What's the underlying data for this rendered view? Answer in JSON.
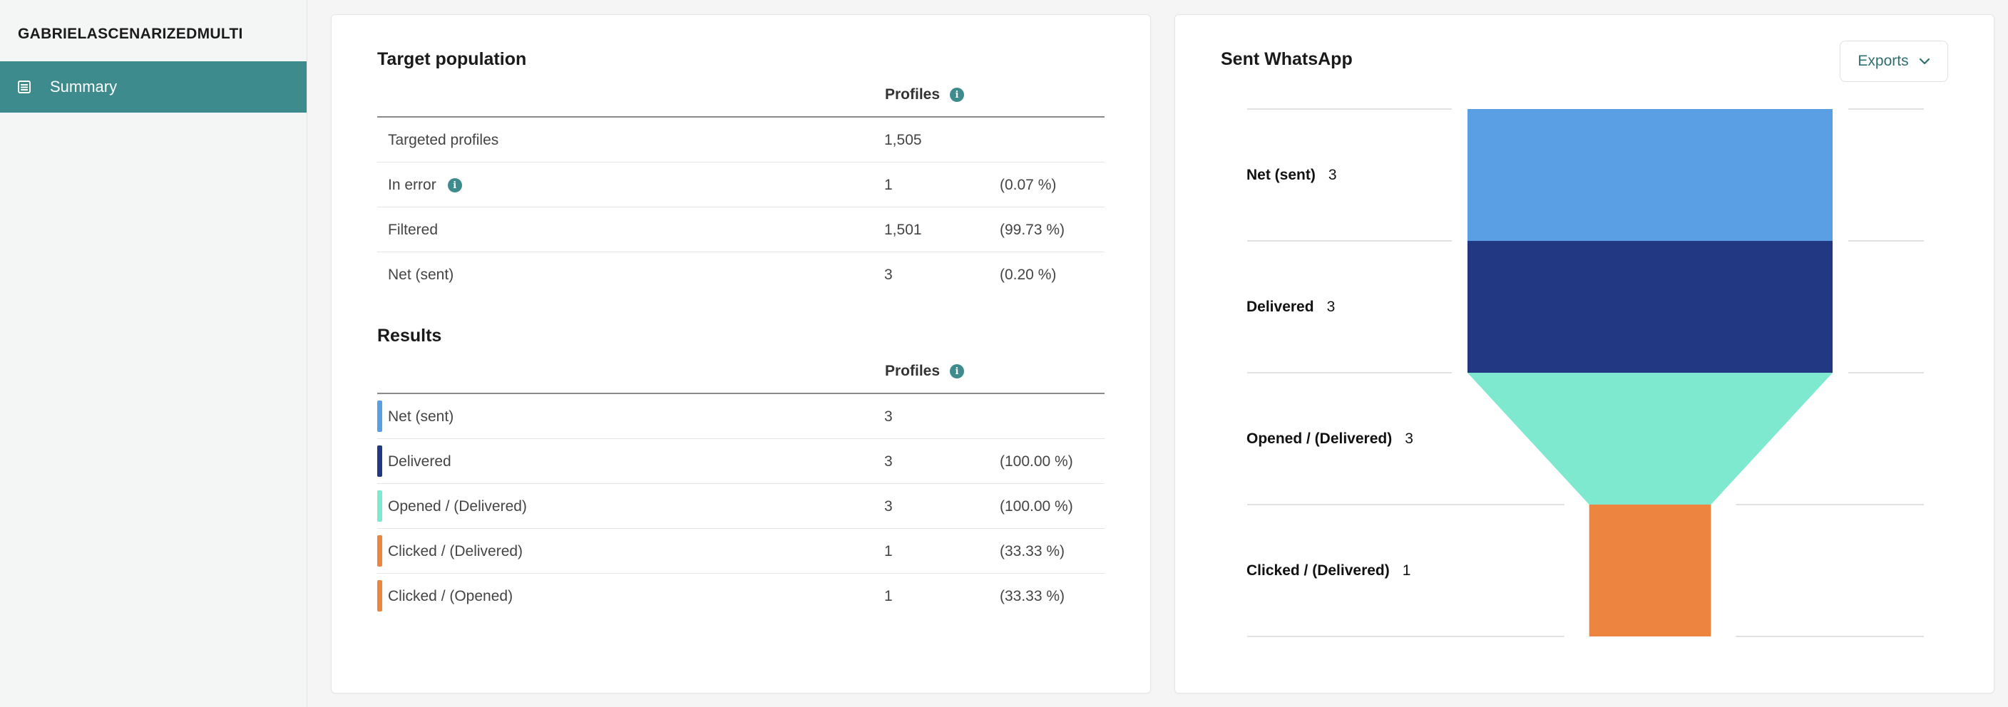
{
  "app": {
    "title": "GABRIELASCENARIZEDMULTI"
  },
  "sidebar": {
    "items": [
      {
        "label": "Summary",
        "icon": "list-icon"
      }
    ]
  },
  "target_population": {
    "title": "Target population",
    "column_header": "Profiles",
    "rows": [
      {
        "label": "Targeted profiles",
        "value": "1,505",
        "pct": ""
      },
      {
        "label": "In error",
        "value": "1",
        "pct": "(0.07 %)",
        "info": true
      },
      {
        "label": "Filtered",
        "value": "1,501",
        "pct": "(99.73 %)"
      },
      {
        "label": "Net (sent)",
        "value": "3",
        "pct": "(0.20 %)"
      }
    ]
  },
  "results": {
    "title": "Results",
    "column_header": "Profiles",
    "rows": [
      {
        "label": "Net (sent)",
        "value": "3",
        "pct": "",
        "color": "#5a9fe3"
      },
      {
        "label": "Delivered",
        "value": "3",
        "pct": "(100.00 %)",
        "color": "#223882"
      },
      {
        "label": "Opened / (Delivered)",
        "value": "3",
        "pct": "(100.00 %)",
        "color": "#7fe9cf"
      },
      {
        "label": "Clicked / (Delivered)",
        "value": "1",
        "pct": "(33.33 %)",
        "color": "#ed8540"
      },
      {
        "label": "Clicked / (Opened)",
        "value": "1",
        "pct": "(33.33 %)",
        "color": "#ed8540"
      }
    ]
  },
  "funnel_panel": {
    "title": "Sent WhatsApp",
    "exports_label": "Exports"
  },
  "chart_data": {
    "type": "funnel",
    "title": "Sent WhatsApp",
    "stages": [
      {
        "label": "Net (sent)",
        "value": 3,
        "color": "#5a9fe3"
      },
      {
        "label": "Delivered",
        "value": 3,
        "color": "#223882"
      },
      {
        "label": "Opened / (Delivered)",
        "value": 3,
        "color": "#7fe9cf"
      },
      {
        "label": "Clicked / (Delivered)",
        "value": 1,
        "color": "#ed8540"
      }
    ]
  }
}
